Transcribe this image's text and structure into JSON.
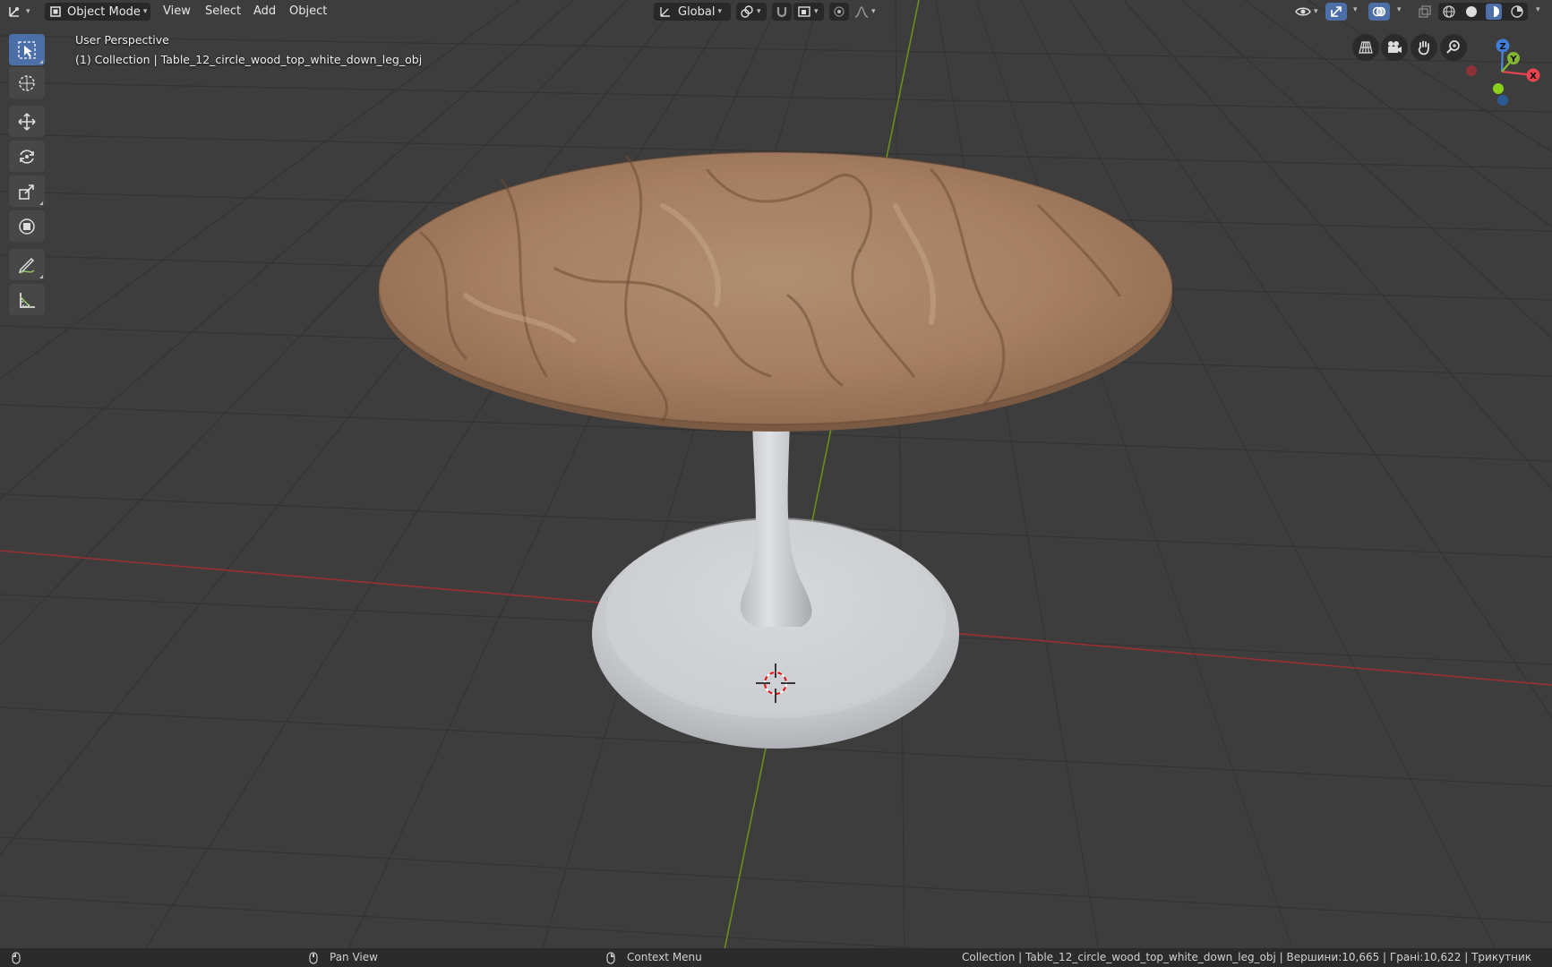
{
  "header": {
    "mode_label": "Object Mode",
    "menus": [
      "View",
      "Select",
      "Add",
      "Object"
    ],
    "transform_orientation": "Global"
  },
  "overlay": {
    "view_name": "User Perspective",
    "collection_info": "(1) Collection | Table_12_circle_wood_top_white_down_leg_obj"
  },
  "gizmo": {
    "x": "X",
    "y": "Y",
    "z": "Z"
  },
  "status_bar": {
    "pan_label": "Pan View",
    "context_label": "Context Menu",
    "stats": "Collection | Table_12_circle_wood_top_white_down_leg_obj | Вершини:10,665 | Грані:10,622 | Трикутник"
  },
  "colors": {
    "grid_bg": "#3d3d3d",
    "x_axis": "#9a2f33",
    "y_axis": "#6b8f1a",
    "accent": "#4d6fa8"
  }
}
